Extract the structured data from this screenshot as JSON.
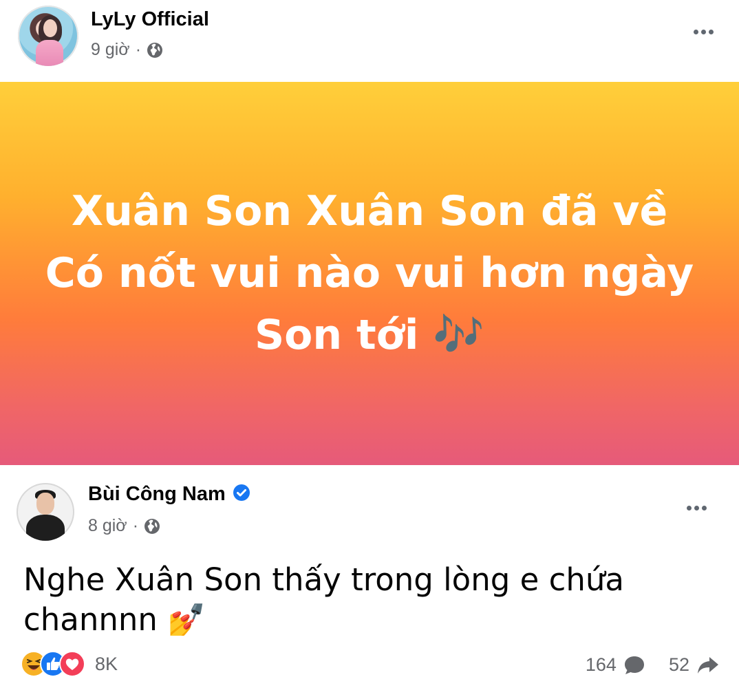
{
  "post1": {
    "author": "LyLy Official",
    "time": "9 giờ",
    "separator": "·",
    "banner_lines": [
      "Xuân Son Xuân Son đã về",
      "Có nốt vui nào vui hơn ngày",
      "Son tới 🎶"
    ]
  },
  "post2": {
    "author": "Bùi Công Nam",
    "time": "8 giờ",
    "separator": "·",
    "text_lines": [
      "Nghe Xuân Son thấy trong lòng e chứa",
      "channnn 💅"
    ],
    "reactions_count": "8K",
    "comments_count": "164",
    "shares_count": "52"
  },
  "colors": {
    "verified": "#1877f2",
    "like": "#1877f2",
    "love": "#f33e58",
    "haha": "#f7b125",
    "meta_gray": "#65676b"
  },
  "icons": [
    "globe-icon",
    "more-options-icon",
    "verified-badge-icon",
    "haha-reaction-icon",
    "like-reaction-icon",
    "love-reaction-icon",
    "comment-icon",
    "share-icon"
  ]
}
